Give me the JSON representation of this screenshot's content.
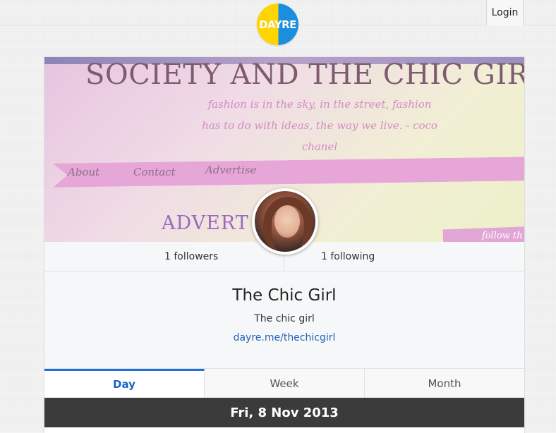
{
  "header": {
    "logo_text": "DAYRE",
    "login_label": "Login"
  },
  "cover": {
    "title": "SOCIETY AND THE CHIC GIR",
    "quote_line1": "fashion is in the sky, in the street, fashion",
    "quote_line2": "has to do with ideas, the way we live. - coco",
    "quote_line3": "chanel",
    "nav": [
      "About",
      "Contact",
      "Advertise"
    ],
    "advert": "ADVERT",
    "follow": "follow th"
  },
  "stats": {
    "followers": "1 followers",
    "following": "1 following"
  },
  "profile": {
    "name": "The Chic Girl",
    "description": "The chic girl",
    "link": "dayre.me/thechicgirl"
  },
  "tabs": [
    {
      "label": "Day",
      "active": true
    },
    {
      "label": "Week",
      "active": false
    },
    {
      "label": "Month",
      "active": false
    }
  ],
  "date_header": "Fri, 8 Nov 2013",
  "colors": {
    "accent": "#1e6fe0",
    "link": "#2361b6",
    "date_band": "#3b3b3b",
    "logo_yellow": "#ffd400",
    "logo_blue": "#1a8fe0"
  }
}
